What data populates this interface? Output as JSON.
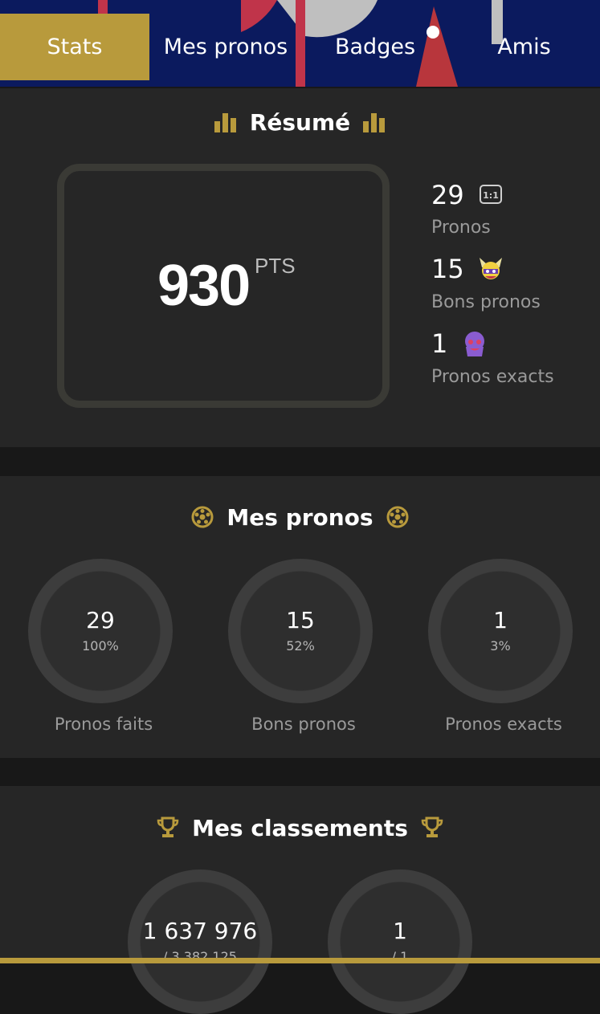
{
  "colors": {
    "accent": "#b89a3c",
    "nav_bg": "#0b1a5e",
    "panel": "#262626",
    "muted": "#9a9a9a"
  },
  "tabs": [
    {
      "label": "Stats",
      "active": true
    },
    {
      "label": "Mes pronos",
      "active": false
    },
    {
      "label": "Badges",
      "active": false
    },
    {
      "label": "Amis",
      "active": false
    }
  ],
  "resume": {
    "title": "Résumé",
    "title_icon": "bar-chart-icon",
    "score": "930",
    "score_unit": "PTS",
    "stats": [
      {
        "value": "29",
        "label": "Pronos",
        "icon": "score-one-one-icon"
      },
      {
        "value": "15",
        "label": "Bons pronos",
        "icon": "mascot-helmet-icon"
      },
      {
        "value": "1",
        "label": "Pronos exacts",
        "icon": "mascot-purple-icon"
      }
    ]
  },
  "mes_pronos": {
    "title": "Mes pronos",
    "title_icon": "soccer-ball-icon",
    "rings": [
      {
        "value": "29",
        "percent": "100%",
        "label": "Pronos faits"
      },
      {
        "value": "15",
        "percent": "52%",
        "label": "Bons pronos"
      },
      {
        "value": "1",
        "percent": "3%",
        "label": "Pronos exacts"
      }
    ]
  },
  "classements": {
    "title": "Mes classements",
    "title_icon": "trophy-icon",
    "rings": [
      {
        "value": "1 637 976",
        "total": "/ 3 382 125"
      },
      {
        "value": "1",
        "total": "/ 1"
      }
    ]
  }
}
